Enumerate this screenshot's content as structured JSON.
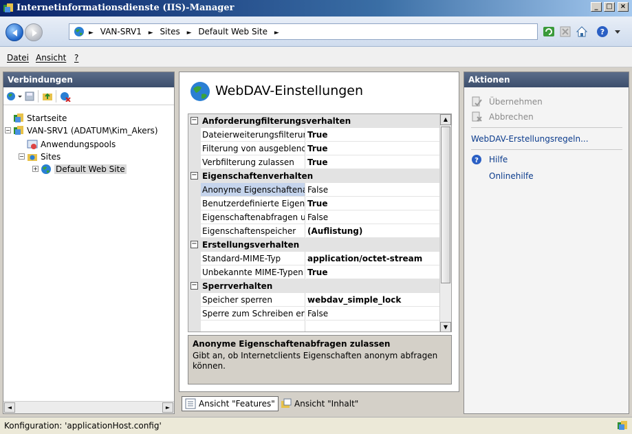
{
  "window": {
    "title": "Internetinformationsdienste (IIS)-Manager",
    "controls": [
      "_",
      "□",
      "×"
    ]
  },
  "address": {
    "crumbs": [
      "VAN-SRV1",
      "Sites",
      "Default Web Site"
    ]
  },
  "menu": {
    "items": [
      "Datei",
      "Ansicht",
      "?"
    ]
  },
  "connections": {
    "header": "Verbindungen",
    "tree": {
      "start": "Startseite",
      "server": "VAN-SRV1 (ADATUM\\Kim_Akers)",
      "apppools": "Anwendungspools",
      "sites": "Sites",
      "defaultsite": "Default Web Site"
    }
  },
  "feature": {
    "title": "WebDAV-Einstellungen",
    "groups": [
      {
        "label": "Anforderungfilterungsverhalten",
        "props": [
          {
            "name": "Dateierweiterungsfilterur",
            "value": "True",
            "bold": true
          },
          {
            "name": "Filterung von ausgeblend",
            "value": "True",
            "bold": true
          },
          {
            "name": "Verbfilterung zulassen",
            "value": "True",
            "bold": true
          }
        ]
      },
      {
        "label": "Eigenschaftenverhalten",
        "props": [
          {
            "name": "Anonyme Eigenschaftena",
            "value": "False",
            "bold": false,
            "selected": true
          },
          {
            "name": "Benutzerdefinierte Eigens",
            "value": "True",
            "bold": true
          },
          {
            "name": "Eigenschaftenabfragen u",
            "value": "False",
            "bold": false
          },
          {
            "name": "Eigenschaftenspeicher",
            "value": "(Auflistung)",
            "bold": true
          }
        ]
      },
      {
        "label": "Erstellungsverhalten",
        "props": [
          {
            "name": "Standard-MIME-Typ",
            "value": "application/octet-stream",
            "bold": true
          },
          {
            "name": "Unbekannte MIME-Typen",
            "value": "True",
            "bold": true
          }
        ]
      },
      {
        "label": "Sperrverhalten",
        "props": [
          {
            "name": "Speicher sperren",
            "value": "webdav_simple_lock",
            "bold": true
          },
          {
            "name": "Sperre zum Schreiben erf",
            "value": "False",
            "bold": false
          }
        ]
      }
    ],
    "description": {
      "title": "Anonyme Eigenschaftenabfragen zulassen",
      "text": "Gibt an, ob Internetclients Eigenschaften anonym abfragen können."
    }
  },
  "viewtabs": {
    "features": "Ansicht \"Features\"",
    "content": "Ansicht \"Inhalt\""
  },
  "actions": {
    "header": "Aktionen",
    "apply": "Übernehmen",
    "cancel": "Abbrechen",
    "rules": "WebDAV-Erstellungsregeln...",
    "help": "Hilfe",
    "onlinehelp": "Onlinehilfe"
  },
  "status": {
    "text": "Konfiguration: 'applicationHost.config'"
  },
  "colors": {
    "titlebar": "#0a246a",
    "pane_header": "#4a5c7a",
    "link": "#0b3b8c",
    "disabled": "#8a8a8a"
  }
}
